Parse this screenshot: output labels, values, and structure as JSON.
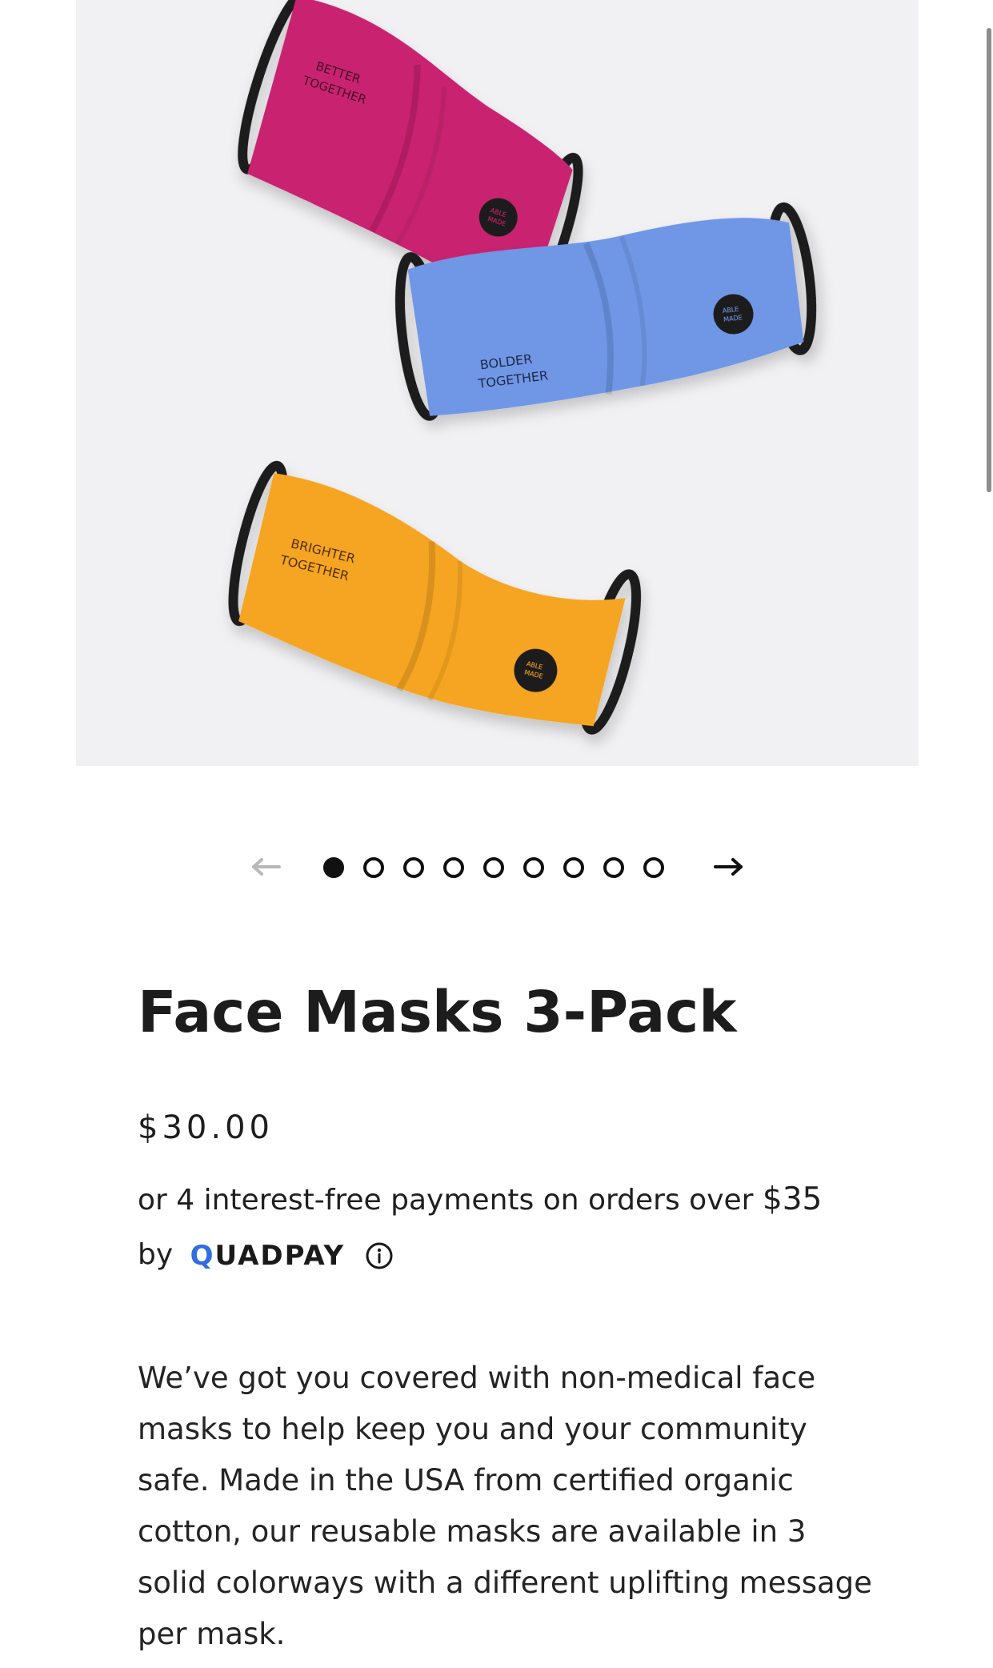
{
  "hero": {
    "image_name": "face-masks-photo",
    "masks": [
      {
        "color": "#c9236f",
        "message": "BETTER TOGETHER",
        "line1": "BETTER",
        "line2": "TOGETHER",
        "badge1": "ABLE",
        "badge2": "MADE"
      },
      {
        "color": "#6f97e6",
        "message": "BOLDER TOGETHER",
        "line1": "BOLDER",
        "line2": "TOGETHER",
        "badge1": "ABLE",
        "badge2": "MADE"
      },
      {
        "color": "#f6a522",
        "message": "BRIGHTER TOGETHER",
        "line1": "BRIGHTER",
        "line2": "TOGETHER",
        "badge1": "ABLE",
        "badge2": "MADE"
      }
    ]
  },
  "carousel": {
    "prev_icon": "arrow-left-icon",
    "next_icon": "arrow-right-icon",
    "slide_count": 9,
    "active_index": 0
  },
  "product": {
    "title": "Face Masks 3-Pack",
    "price": "$30.00",
    "installments_prefix": "or 4 interest-free payments on orders over ",
    "installments_amount": "$35",
    "installments_by": "by",
    "provider_q": "Q",
    "provider_rest": "UADPAY",
    "info_icon": "info-icon",
    "description": "We’ve got you covered with non-medical face masks to help keep you and your community safe. Made in the USA from certified organic cotton, our reusable masks are available in 3 solid colorways with a different uplifting message per mask."
  },
  "colors": {
    "accent_quadpay": "#2f6de1",
    "text": "#1f1f1f",
    "hero_background": "#f1f1f3"
  }
}
